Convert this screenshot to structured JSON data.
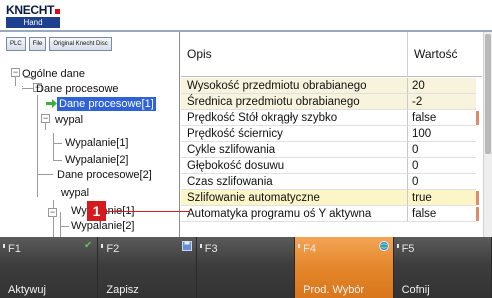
{
  "logo": {
    "brand": "KNECHT",
    "sub": "Hand"
  },
  "toolbar": {
    "buttons": [
      "PLC",
      "File",
      "Original Knecht Disc"
    ]
  },
  "tree": {
    "items": [
      {
        "label": "Ogólne dane"
      },
      {
        "label": "Dane procesowe"
      },
      {
        "label": "Dane procesowe[1]"
      },
      {
        "label": "wypal"
      },
      {
        "label": "Wypalanie[1]"
      },
      {
        "label": "Wypalanie[2]"
      },
      {
        "label": "Dane procesowe[2]"
      },
      {
        "label": "wypal"
      },
      {
        "label": "Wypalanie[1]"
      },
      {
        "label": "Wypalanie[2]"
      }
    ]
  },
  "callout": {
    "number": "1"
  },
  "table": {
    "headers": {
      "name": "Opis",
      "value": "Wartość"
    },
    "rows": [
      {
        "name": "Wysokość przedmiotu obrabianego",
        "value": "20"
      },
      {
        "name": "Średnica przedmiotu obrabianego",
        "value": "-2"
      },
      {
        "name": "Prędkość Stół okrągły szybko",
        "value": "false"
      },
      {
        "name": "Prędkość ściernicy",
        "value": "100"
      },
      {
        "name": "Cykle szlifowania",
        "value": "0"
      },
      {
        "name": "Głębokość dosuwu",
        "value": "0"
      },
      {
        "name": "Czas szlifowania",
        "value": "0"
      },
      {
        "name": "Szlifowanie automatyczne",
        "value": "true"
      },
      {
        "name": "Automatyka programu oś Y aktywna",
        "value": "false"
      }
    ]
  },
  "fkeys": [
    {
      "code": "F1",
      "label": "Aktywuj",
      "icon": "checkmark-icon"
    },
    {
      "code": "F2",
      "label": "Zapisz",
      "icon": "floppy-icon"
    },
    {
      "code": "F3",
      "label": "",
      "icon": ""
    },
    {
      "code": "F4",
      "label": "Prod. Wybór",
      "icon": "globe-icon"
    },
    {
      "code": "F5",
      "label": "Cofnij",
      "icon": ""
    }
  ],
  "colors": {
    "accent": "#e4862a",
    "selection": "#2f62d6",
    "badge": "#d4191f",
    "bar": "#3d3d3d"
  }
}
